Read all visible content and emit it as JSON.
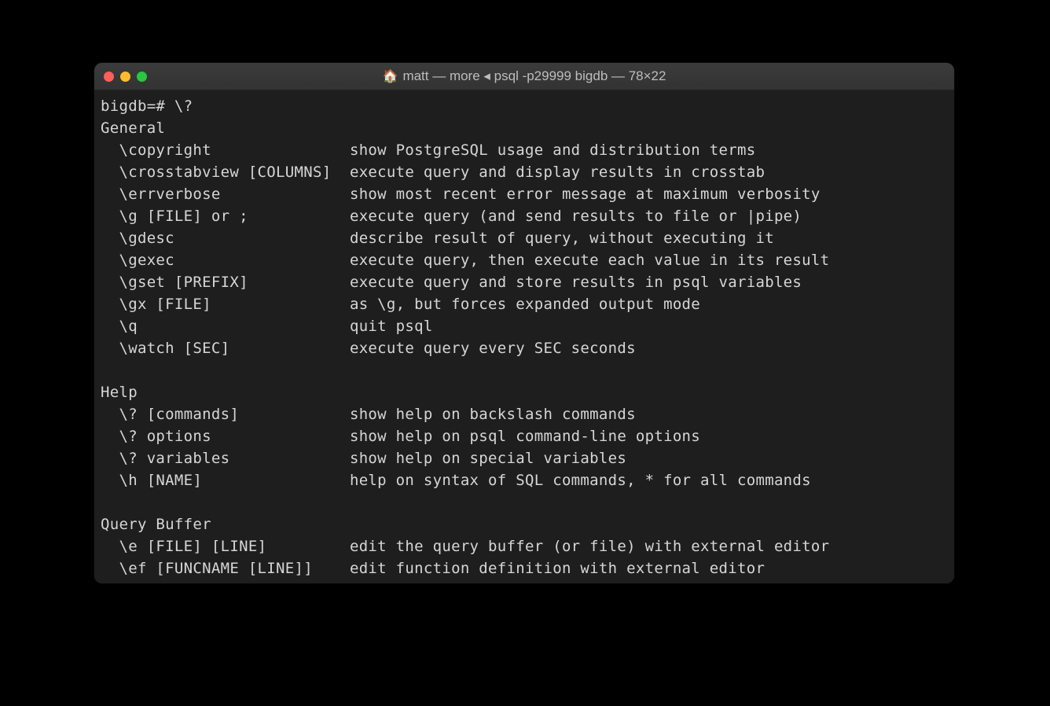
{
  "window": {
    "title": "matt — more ◂ psql -p29999 bigdb — 78×22"
  },
  "terminal": {
    "prompt": "bigdb=# \\?",
    "sections": [
      {
        "heading": "General",
        "items": [
          {
            "cmd": "\\copyright",
            "desc": "show PostgreSQL usage and distribution terms"
          },
          {
            "cmd": "\\crosstabview [COLUMNS]",
            "desc": "execute query and display results in crosstab"
          },
          {
            "cmd": "\\errverbose",
            "desc": "show most recent error message at maximum verbosity"
          },
          {
            "cmd": "\\g [FILE] or ;",
            "desc": "execute query (and send results to file or |pipe)"
          },
          {
            "cmd": "\\gdesc",
            "desc": "describe result of query, without executing it"
          },
          {
            "cmd": "\\gexec",
            "desc": "execute query, then execute each value in its result"
          },
          {
            "cmd": "\\gset [PREFIX]",
            "desc": "execute query and store results in psql variables"
          },
          {
            "cmd": "\\gx [FILE]",
            "desc": "as \\g, but forces expanded output mode"
          },
          {
            "cmd": "\\q",
            "desc": "quit psql"
          },
          {
            "cmd": "\\watch [SEC]",
            "desc": "execute query every SEC seconds"
          }
        ]
      },
      {
        "heading": "Help",
        "items": [
          {
            "cmd": "\\? [commands]",
            "desc": "show help on backslash commands"
          },
          {
            "cmd": "\\? options",
            "desc": "show help on psql command-line options"
          },
          {
            "cmd": "\\? variables",
            "desc": "show help on special variables"
          },
          {
            "cmd": "\\h [NAME]",
            "desc": "help on syntax of SQL commands, * for all commands"
          }
        ]
      },
      {
        "heading": "Query Buffer",
        "items": [
          {
            "cmd": "\\e [FILE] [LINE]",
            "desc": "edit the query buffer (or file) with external editor"
          },
          {
            "cmd": "\\ef [FUNCNAME [LINE]]",
            "desc": "edit function definition with external editor"
          }
        ]
      }
    ]
  }
}
